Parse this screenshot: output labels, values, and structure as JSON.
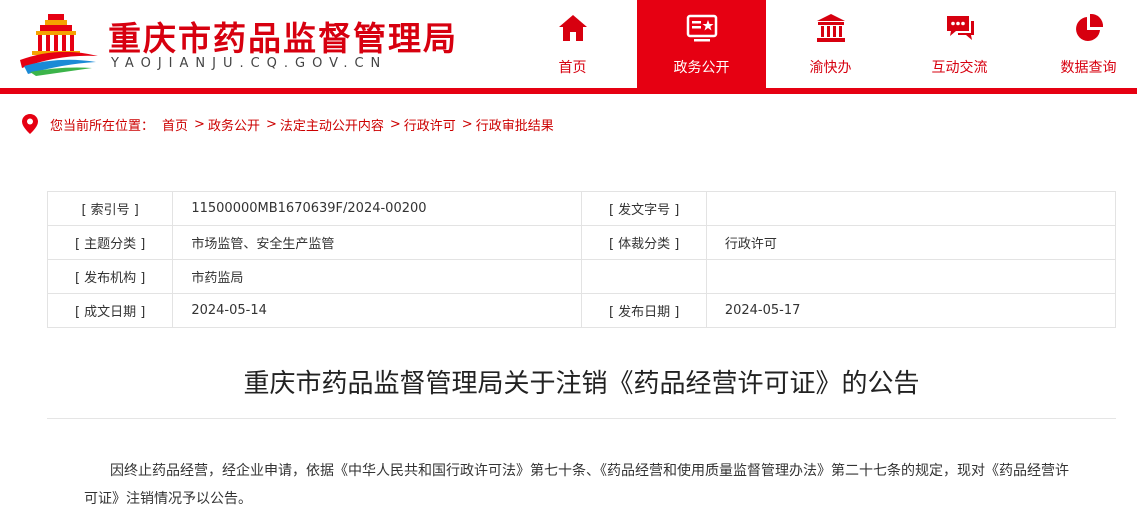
{
  "header": {
    "site_title": "重庆市药品监督管理局",
    "site_domain": "YAOJIANJU.CQ.GOV.CN",
    "brand_color": "#e60012",
    "nav": [
      {
        "label": "首页",
        "icon": "home-icon",
        "active": false
      },
      {
        "label": "政务公开",
        "icon": "government-info-icon",
        "active": true
      },
      {
        "label": "渝快办",
        "icon": "service-hall-icon",
        "active": false
      },
      {
        "label": "互动交流",
        "icon": "chat-icon",
        "active": false
      },
      {
        "label": "数据查询",
        "icon": "pie-chart-icon",
        "active": false
      }
    ]
  },
  "breadcrumb": {
    "prefix": "您当前所在位置：",
    "items": [
      "首页",
      "政务公开",
      "法定主动公开内容",
      "行政许可",
      "行政审批结果"
    ],
    "separator": ">"
  },
  "meta": {
    "rows": [
      {
        "l1": "[ 索引号 ]",
        "v1": "11500000MB1670639F/2024-00200",
        "l2": "[ 发文字号 ]",
        "v2": ""
      },
      {
        "l1": "[ 主题分类 ]",
        "v1": "市场监管、安全生产监管",
        "l2": "[ 体裁分类 ]",
        "v2": "行政许可"
      },
      {
        "l1": "[ 发布机构 ]",
        "v1": "市药监局",
        "l2": "",
        "v2": ""
      },
      {
        "l1": "[ 成文日期 ]",
        "v1": "2024-05-14",
        "l2": "[ 发布日期 ]",
        "v2": "2024-05-17"
      }
    ]
  },
  "article": {
    "title": "重庆市药品监督管理局关于注销《药品经营许可证》的公告",
    "paragraph": "因终止药品经营，经企业申请，依据《中华人民共和国行政许可法》第七十条、《药品经营和使用质量监督管理办法》第二十七条的规定，现对《药品经营许可证》注销情况予以公告。"
  }
}
